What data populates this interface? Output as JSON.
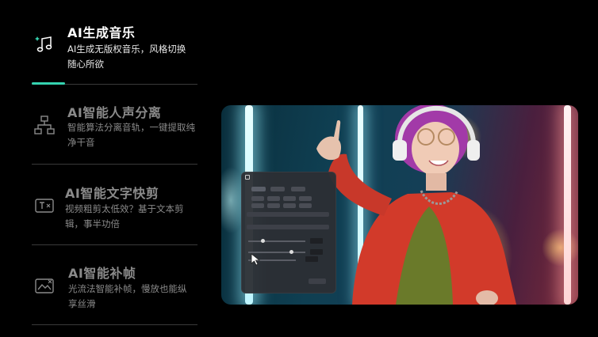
{
  "features": [
    {
      "title": "AI生成音乐",
      "desc": "AI生成无版权音乐，风格切换随心所欲",
      "icon": "music-note-icon",
      "active": true,
      "progress": 0.2
    },
    {
      "title": "AI智能人声分离",
      "desc": "智能算法分离音轨，一键提取纯净干音",
      "icon": "org-chart-icon",
      "active": false
    },
    {
      "title": "AI智能文字快剪",
      "desc": "视频粗剪太低效？基于文本剪辑，事半功倍",
      "icon": "text-cut-icon",
      "active": false
    },
    {
      "title": "AI智能补帧",
      "desc": "光流法智能补帧，慢放也能纵享丝滑",
      "icon": "frame-interpolation-icon",
      "active": false
    }
  ],
  "colors": {
    "accent": "#35d3b0",
    "active_text": "#ffffff",
    "inactive_text": "#8a8a8a",
    "divider": "#3a3a3a"
  },
  "preview": {
    "panel_icon": "panel-settings-icon",
    "cursor_icon": "cursor-icon"
  }
}
